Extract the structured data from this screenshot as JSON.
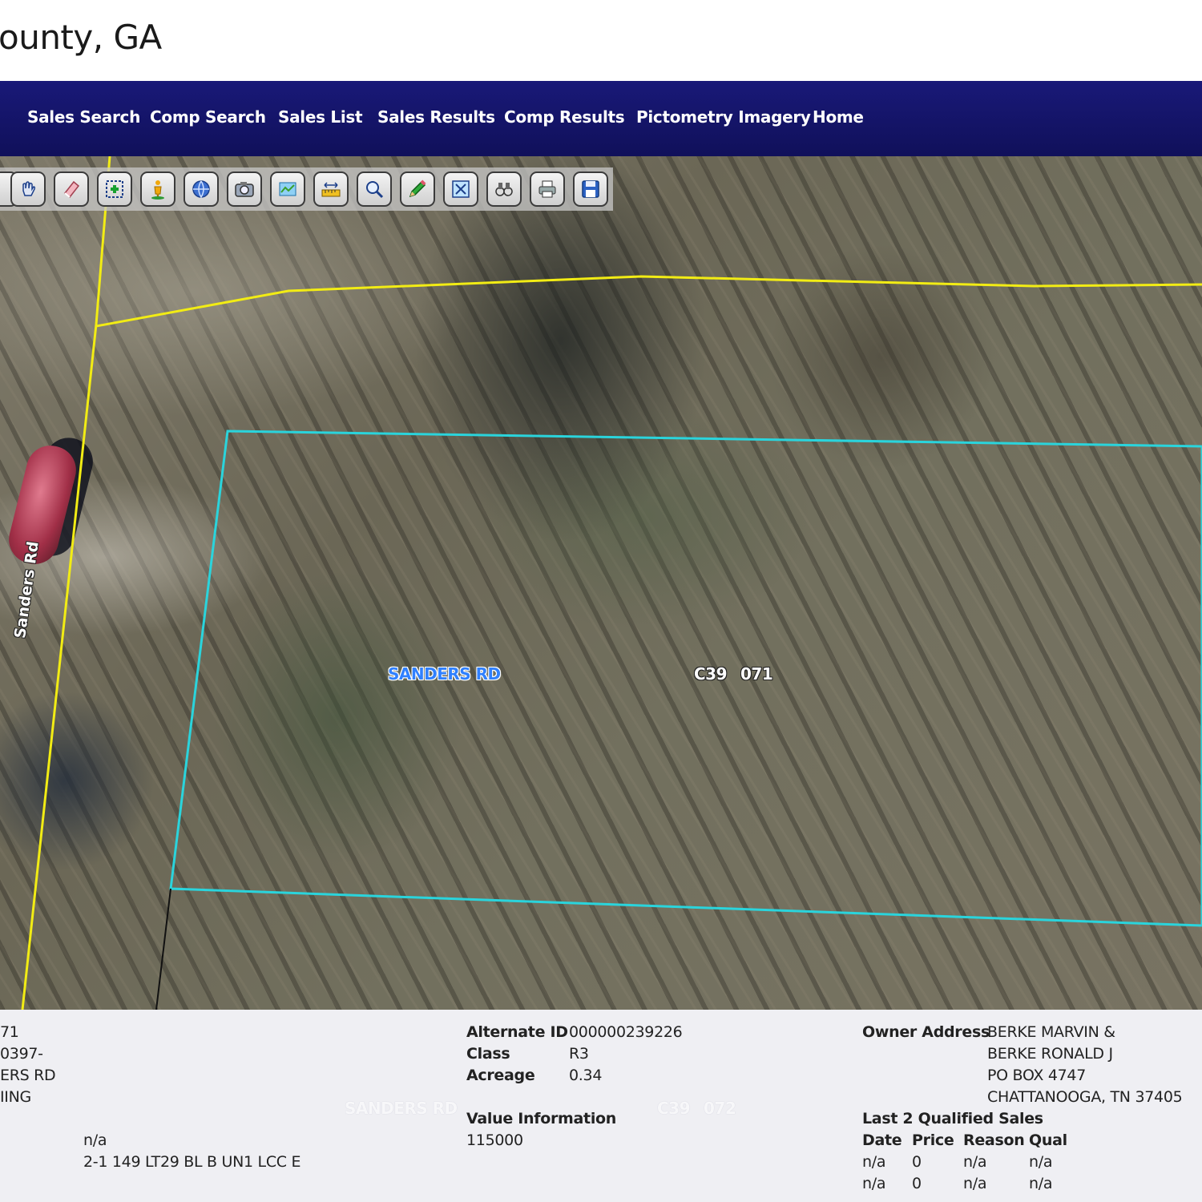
{
  "header": {
    "title": "ounty, GA"
  },
  "nav": {
    "items": [
      {
        "label": "Sales Search"
      },
      {
        "label": "Comp Search"
      },
      {
        "label": "Sales List"
      },
      {
        "label": "Sales Results"
      },
      {
        "label": "Comp Results"
      },
      {
        "label": "Pictometry Imagery"
      },
      {
        "label": "Home"
      }
    ]
  },
  "toolbar": {
    "tools": [
      {
        "icon": "hand-pan-icon"
      },
      {
        "icon": "eraser-icon"
      },
      {
        "icon": "select-box-icon"
      },
      {
        "icon": "street-view-icon"
      },
      {
        "icon": "globe-icon"
      },
      {
        "icon": "camera-icon"
      },
      {
        "icon": "layers-icon"
      },
      {
        "icon": "measure-icon"
      },
      {
        "icon": "zoom-icon"
      },
      {
        "icon": "pencil-icon"
      },
      {
        "icon": "full-extent-icon"
      },
      {
        "icon": "binoculars-icon"
      },
      {
        "icon": "print-icon"
      },
      {
        "icon": "save-icon"
      }
    ]
  },
  "map": {
    "road_label": "SANDERS RD",
    "parcel_label_a": "C39",
    "parcel_label_b": "071",
    "street_label": "Sanders Rd",
    "ghost_road_label": "SANDERS RD",
    "ghost_parcel_a": "C39",
    "ghost_parcel_b": "072",
    "colors": {
      "parcel_outline": "#2ad4dc",
      "road_line": "#f2ec14"
    }
  },
  "info": {
    "left": {
      "line1": "71",
      "line2": "0397-",
      "line3": "ERS RD",
      "line4": "IING",
      "value_na": "n/a",
      "legal": "2-1 149 LT29 BL B UN1 LCC E"
    },
    "middle": {
      "alt_id_label": "Alternate ID",
      "alt_id_value": "000000239226",
      "class_label": "Class",
      "class_value": "R3",
      "acreage_label": "Acreage",
      "acreage_value": "0.34",
      "value_info_label": "Value Information",
      "value_info_value": "115000"
    },
    "right": {
      "owner_label": "Owner Address",
      "owner_lines": [
        "BERKE MARVIN &",
        "BERKE RONALD J",
        "PO BOX 4747",
        "CHATTANOOGA, TN 37405"
      ],
      "sales_title": "Last 2 Qualified Sales",
      "sales_headers": [
        "Date",
        "Price",
        "Reason",
        "Qual"
      ],
      "sales_rows": [
        [
          "n/a",
          "0",
          "n/a",
          "n/a"
        ],
        [
          "n/a",
          "0",
          "n/a",
          "n/a"
        ]
      ]
    }
  }
}
